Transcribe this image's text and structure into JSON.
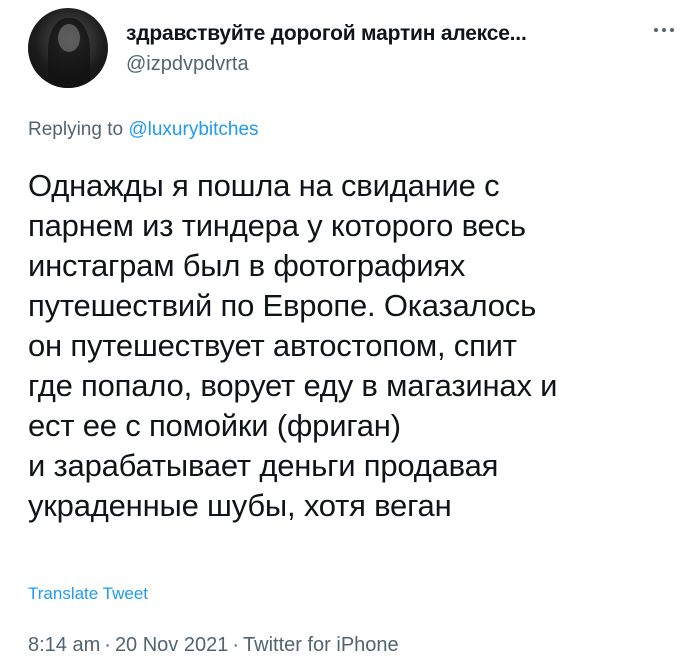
{
  "author": {
    "display_name": "здравствуйте дорогой мартин алексе...",
    "handle": "@izpdvpdvrta",
    "avatar_icon": "profile-photo"
  },
  "more_icon": "more-horizontal-icon",
  "reply": {
    "prefix": "Replying to ",
    "mention": "@luxurybitches"
  },
  "body_lines": [
    "Однажды я пошла на свидание с",
    "парнем из тиндера у которого весь",
    "инстаграм был в фотографиях",
    "путешествий по Европе. Оказалось",
    "он путешествует автостопом, спит",
    "где попало, ворует еду в магазинах и",
    "ест ее с помойки (фриган)",
    "и зарабатывает деньги продавая",
    "украденные шубы, хотя веган"
  ],
  "translate_label": "Translate Tweet",
  "meta": {
    "time": "8:14 am",
    "separator": "·",
    "date": "20 Nov 2021",
    "source": "Twitter for iPhone"
  },
  "colors": {
    "text": "#0f1419",
    "secondary": "#536471",
    "link": "#1d9bf0"
  }
}
